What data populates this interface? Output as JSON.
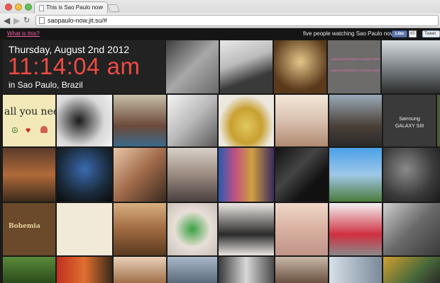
{
  "browser": {
    "tab_title": "This is Sao Paulo now",
    "tab_close": "×",
    "url": "saopaulo-now.jit.su/#",
    "back_icon": "◀",
    "forward_icon": "▶",
    "reload_icon": "↻"
  },
  "header": {
    "what_is_this": "What is this?",
    "watching_text": "five people watching Sao Paulo now",
    "like_label": "Like",
    "like_count": "65",
    "tweet_label": "Tweet"
  },
  "clock": {
    "date": "Thursday, August 2nd 2012",
    "time": "11:14:04 am",
    "location": "in Sao Paulo, Brazil"
  },
  "photo_texts": {
    "love": "all you need is",
    "samsung": "Samsung GALAXY SIII",
    "bohemia": "Bohemia",
    "pink_line1": "USER EXPERIENCE IS EVERYTHING",
    "pink_line2": "USER EXPERIENCE IS EVERYTHING"
  },
  "colors": {
    "accent_pink": "#f05fa0",
    "clock_red": "#ef4a42",
    "page_bg": "#1a1a1a"
  }
}
